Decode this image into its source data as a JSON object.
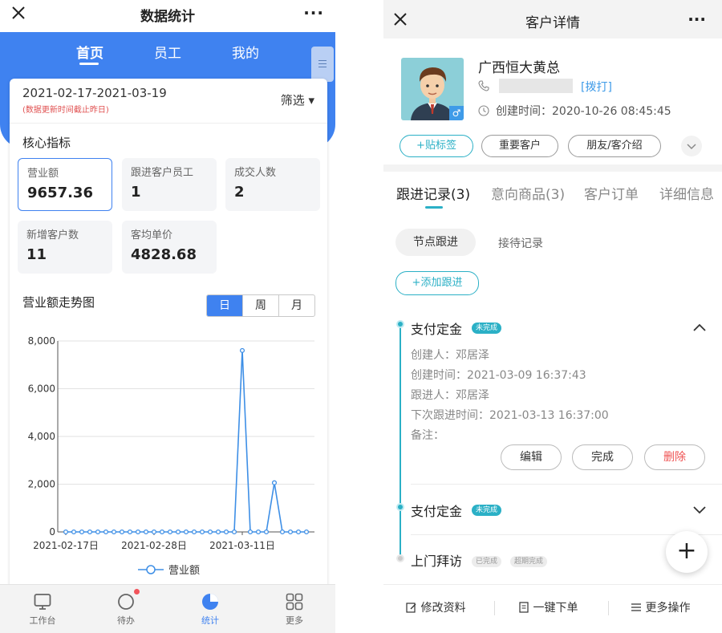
{
  "left": {
    "title": "数据统计",
    "more": "···",
    "tabs": [
      "首页",
      "员工",
      "我的"
    ],
    "date_range": "2021-02-17-2021-03-19",
    "date_note": "(数据更新时间截止昨日)",
    "filter_label": "筛选 ▾",
    "core_title": "核心指标",
    "metrics": [
      {
        "label": "营业额",
        "value": "9657.36"
      },
      {
        "label": "跟进客户员工",
        "value": "1"
      },
      {
        "label": "成交人数",
        "value": "2"
      },
      {
        "label": "新增客户数",
        "value": "11"
      },
      {
        "label": "客均单价",
        "value": "4828.68"
      }
    ],
    "trend_title": "营业额走势图",
    "period_options": [
      "日",
      "周",
      "月"
    ],
    "period_selected": "日",
    "nav": [
      {
        "label": "工作台",
        "icon": "workbench-icon"
      },
      {
        "label": "待办",
        "icon": "todo-icon"
      },
      {
        "label": "统计",
        "icon": "stats-icon"
      },
      {
        "label": "更多",
        "icon": "grid-icon"
      }
    ],
    "colors": {
      "brand": "#3f82f0",
      "line": "#3e8fe6",
      "badge": "#f2545b"
    }
  },
  "chart_data": {
    "type": "line",
    "title": "营业额走势图",
    "xlabel": "",
    "ylabel": "",
    "x": [
      "2021-02-17",
      "2021-02-18",
      "2021-02-19",
      "2021-02-20",
      "2021-02-21",
      "2021-02-22",
      "2021-02-23",
      "2021-02-24",
      "2021-02-25",
      "2021-02-26",
      "2021-02-27",
      "2021-02-28",
      "2021-03-01",
      "2021-03-02",
      "2021-03-03",
      "2021-03-04",
      "2021-03-05",
      "2021-03-06",
      "2021-03-07",
      "2021-03-08",
      "2021-03-09",
      "2021-03-10",
      "2021-03-11",
      "2021-03-12",
      "2021-03-13",
      "2021-03-14",
      "2021-03-15",
      "2021-03-16",
      "2021-03-17",
      "2021-03-18",
      "2021-03-19"
    ],
    "x_tick_labels": [
      "2021-02-17日",
      "2021-02-28日",
      "2021-03-11日"
    ],
    "series": [
      {
        "name": "营业额",
        "values": [
          0,
          0,
          0,
          0,
          0,
          0,
          0,
          0,
          0,
          0,
          0,
          0,
          0,
          0,
          0,
          0,
          0,
          0,
          0,
          0,
          0,
          0,
          7600,
          0,
          0,
          0,
          2060,
          0,
          0,
          0,
          0
        ]
      }
    ],
    "y_ticks": [
      "0",
      "2,000",
      "4,000",
      "6,000",
      "8,000"
    ],
    "ylim": [
      0,
      8000
    ],
    "grid": true,
    "legend": "bottom"
  },
  "right": {
    "title": "客户详情",
    "more": "···",
    "customer_name": "广西恒大黄总",
    "dial_label": "[拨打]",
    "created_label": "创建时间：",
    "created_time": "2020-10-26 08:45:45",
    "gender_symbol": "♂",
    "tags": [
      "+贴标签",
      "重要客户",
      "朋友/客介绍"
    ],
    "tabs": [
      "跟进记录(3)",
      "意向商品(3)",
      "客户订单",
      "详细信息"
    ],
    "subtabs": [
      "节点跟进",
      "接待记录"
    ],
    "add_followup": "+添加跟进",
    "records": [
      {
        "title": "支付定金",
        "status": "未完成"
      },
      {
        "title": "支付定金",
        "status": "未完成"
      },
      {
        "title": "上门拜访",
        "status": "已完成",
        "status2": "超期完成"
      }
    ],
    "detail": {
      "creator": "创建人：邓居泽",
      "created": "创建时间：2021-03-09 16:37:43",
      "follower": "跟进人：邓居泽",
      "next": "下次跟进时间：2021-03-13 16:37:00",
      "remark": "备注："
    },
    "actions": [
      "编辑",
      "完成",
      "删除"
    ],
    "fab": "+",
    "bottom": [
      "修改资料",
      "一键下单",
      "更多操作"
    ],
    "colors": {
      "accent": "#2bb0c6",
      "danger": "#ef5252",
      "link": "#3f9be8"
    }
  }
}
